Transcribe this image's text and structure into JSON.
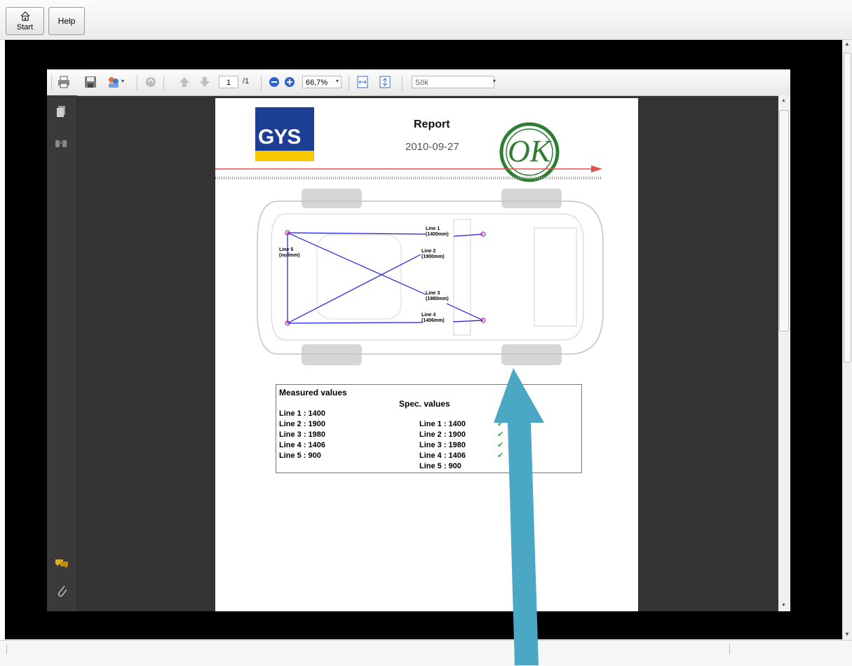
{
  "toolbar": {
    "start_label": "Start",
    "help_label": "Help"
  },
  "pdf_toolbar": {
    "page_current": "1",
    "page_total": "/1",
    "zoom": "66,7%",
    "search_placeholder": "Sök"
  },
  "report": {
    "title": "Report",
    "date": "2010-09-27",
    "logo_text": "GYS",
    "stamp_text": "OK",
    "lines": [
      {
        "label": "Line 1",
        "value": "(1400mm)"
      },
      {
        "label": "Line 2",
        "value": "(1900mm)"
      },
      {
        "label": "Line 3",
        "value": "(1980mm)"
      },
      {
        "label": "Line 4",
        "value": "(1406mm)"
      },
      {
        "label": "Line 5",
        "value": "(nullmm)"
      }
    ],
    "measured_header": "Measured values",
    "spec_header": "Spec. values",
    "measured": [
      "Line 1 : 1400",
      "Line 2 : 1900",
      "Line 3 : 1980",
      "Line 4 : 1406",
      "Line 5 : 900"
    ],
    "spec": [
      "Line 1 : 1400",
      "Line 2 : 1900",
      "Line 3 : 1980",
      "Line 4 : 1406",
      "Line 5 : 900"
    ],
    "check_mark": "✔"
  },
  "colors": {
    "arrow": "#4aa8c4",
    "line": "#1a1af0",
    "stamp": "#2e7d32",
    "logo_blue": "#1c3f94",
    "logo_yellow": "#f6c800"
  }
}
